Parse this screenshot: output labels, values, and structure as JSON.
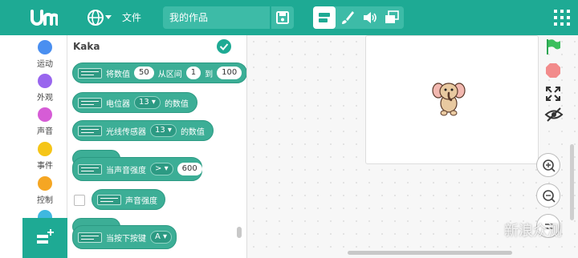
{
  "topbar": {
    "file_menu": "文件",
    "project_name": "我的作品"
  },
  "categories": [
    {
      "label": "运动",
      "color": "#4a8ff0"
    },
    {
      "label": "外观",
      "color": "#9966ee"
    },
    {
      "label": "声音",
      "color": "#d65cd6"
    },
    {
      "label": "事件",
      "color": "#f5c518"
    },
    {
      "label": "控制",
      "color": "#f5a623"
    }
  ],
  "palette": {
    "title": "Kaka",
    "blocks": {
      "map": {
        "prefix": "将数值",
        "value": "50",
        "mid": "从区间",
        "low": "1",
        "to": "到",
        "high": "100"
      },
      "pot": {
        "label": "电位器",
        "port": "13",
        "suffix": "的数值"
      },
      "light": {
        "label": "光线传感器",
        "port": "13",
        "suffix": "的数值"
      },
      "sound_hat": {
        "label": "当声音强度",
        "op": ">",
        "value": "600"
      },
      "sound_reporter": {
        "label": "声音强度"
      },
      "key_hat": {
        "label": "当按下按键",
        "key": "A"
      }
    }
  },
  "colors": {
    "brand": "#1eaa94",
    "block": "#3cae96"
  },
  "watermark": "新浪众测"
}
